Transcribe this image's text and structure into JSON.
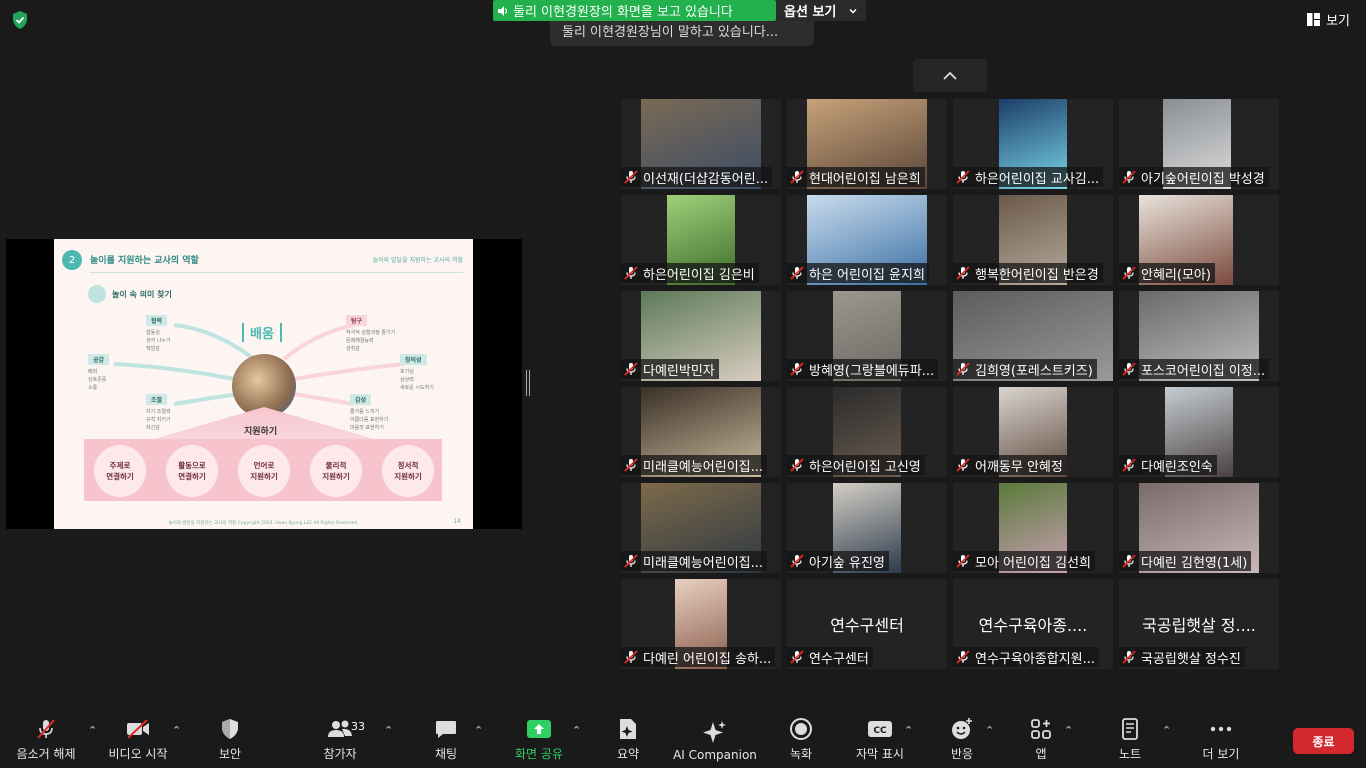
{
  "top": {
    "share_banner": "둘리 이현경원장의 화면을 보고 있습니다",
    "options_label": "옵션 보기",
    "tooltip": "둘리 이현경원장님이 말하고 있습니다...",
    "view_label": "보기"
  },
  "slide": {
    "number": "2",
    "title": "놀이를 지원하는 교사의 역할",
    "header_right": "놀이와 발달을 지원하는 교사의 역할",
    "subtitle": "놀이 속 의미 찾기",
    "center_word": "배움",
    "support_label": "지원하기",
    "nodes": [
      {
        "tag": "협력",
        "items": [
          "협동심",
          "생각 나누기",
          "책임감"
        ]
      },
      {
        "tag": "공감",
        "items": [
          "배려",
          "상호존중",
          "소통"
        ]
      },
      {
        "tag": "조절",
        "items": [
          "자기 조절력",
          "규칙 지키기",
          "자신감"
        ]
      },
      {
        "tag": "탐구",
        "items": [
          "적극적 상황과정 즐기기",
          "문제해결능력",
          "성취감"
        ]
      },
      {
        "tag": "창의성",
        "items": [
          "호기심",
          "상상력",
          "새로운 시도하기"
        ]
      },
      {
        "tag": "감성",
        "items": [
          "즐거움 느끼기",
          "아름다움 표현하기",
          "마음껏 표현하기"
        ]
      }
    ],
    "circles": [
      {
        "l1": "주제로",
        "l2": "연결하기"
      },
      {
        "l1": "활동으로",
        "l2": "연결하기"
      },
      {
        "l1": "언어로",
        "l2": "지원하기"
      },
      {
        "l1": "물리적",
        "l2": "지원하기"
      },
      {
        "l1": "정서적",
        "l2": "지원하기"
      }
    ],
    "footer": "놀이와 발달을 지원하는 교사의 역할 Copyright 2024. Hoon Kyung LEE All Rights Reserved.",
    "page": "14"
  },
  "participants": [
    {
      "name": "이선재(더샵감동어린..."
    },
    {
      "name": "현대어린이집 남은희"
    },
    {
      "name": "하은어린이집 교사김..."
    },
    {
      "name": "아기숲어린이집 박성경"
    },
    {
      "name": "하은어린이집 김은비"
    },
    {
      "name": "하은 어린이집 윤지희"
    },
    {
      "name": "행복한어린이집 반은경"
    },
    {
      "name": "안혜리(모아)"
    },
    {
      "name": "다예린박민자"
    },
    {
      "name": "방혜영(그랑블에듀파..."
    },
    {
      "name": "김희영(포레스트키즈)"
    },
    {
      "name": "포스코어린이집 이정..."
    },
    {
      "name": "미래클예능어린이집..."
    },
    {
      "name": "하은어린이집 고신영"
    },
    {
      "name": "어깨동무 안혜정"
    },
    {
      "name": "다예린조인숙"
    },
    {
      "name": "미래클예능어린이집..."
    },
    {
      "name": "아기숲 유진영"
    },
    {
      "name": "모아 어린이집 김선희"
    },
    {
      "name": "다예린 김현영(1세)"
    },
    {
      "name": "다예린 어린이집 송하..."
    },
    {
      "name": "연수구센터",
      "big": "연수구센터"
    },
    {
      "name": "연수구육아종합지원...",
      "big": "연수구육아종...."
    },
    {
      "name": "국공립햇살 정수진",
      "big": "국공립햇살 정...."
    }
  ],
  "toolbar": {
    "unmute": "음소거 해제",
    "start_video": "비디오 시작",
    "security": "보안",
    "participants": "참가자",
    "participants_count": "33",
    "chat": "채팅",
    "share_screen": "화면 공유",
    "summary": "요약",
    "ai_companion": "AI Companion",
    "record": "녹화",
    "captions": "자막 표시",
    "reactions": "반응",
    "apps": "앱",
    "notes": "노트",
    "more": "더 보기",
    "end": "종료"
  },
  "colors": {
    "share_green": "#22b14c",
    "end_red": "#d3282c",
    "mute_red": "#e02b2b"
  }
}
